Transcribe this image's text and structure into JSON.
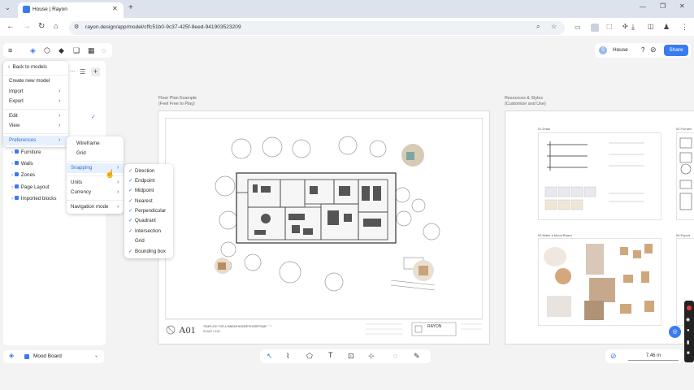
{
  "browser": {
    "tab_title": "House | Rayon",
    "url": "rayon.design/app/model/cffc51b0-9c37-425f-8eed-941903523209"
  },
  "topbar": {
    "project_name": "House",
    "avatar_initial": "S",
    "help": "?",
    "share_label": "Share"
  },
  "main_menu": {
    "back": "Back to models",
    "create": "Create new model",
    "import": "Import",
    "export": "Export",
    "edit": "Edit",
    "view": "View",
    "preferences": "Preferences"
  },
  "preferences_menu": {
    "wireframe": "Wireframe",
    "grid": "Grid",
    "snapping": "Snapping",
    "units": "Units",
    "currency": "Currency",
    "navigation_mode": "Navigation mode"
  },
  "snapping_menu": {
    "items": [
      {
        "label": "Direction",
        "checked": true
      },
      {
        "label": "Endpoint",
        "checked": true
      },
      {
        "label": "Midpoint",
        "checked": true
      },
      {
        "label": "Nearest",
        "checked": true
      },
      {
        "label": "Perpendicular",
        "checked": true
      },
      {
        "label": "Quadrant",
        "checked": true
      },
      {
        "label": "Intersection",
        "checked": true
      },
      {
        "label": "Grid",
        "checked": false
      },
      {
        "label": "Bounding box",
        "checked": true
      }
    ]
  },
  "layers": {
    "items": [
      "Furniture",
      "Walls",
      "Zones",
      "Page Layout",
      "Imported blocks"
    ]
  },
  "canvas": {
    "sheet1_title": "Floor Plan Example",
    "sheet1_subtitle": "(Feel Free to Play)",
    "sheet2_title": "Resources & Styles",
    "sheet2_subtitle": "(Customize and Use)",
    "sheet_code": "A01",
    "sheet_desc": "TEMPLATE FOR A SINGLE HOUSE FLOOR PLAN",
    "sheet_scale": "SCALE 1:100",
    "brand": "RAYON",
    "panel1": "01 Draw",
    "panel2": "02 Furnish",
    "panel3": "03 Make a Mood Board",
    "panel4": "04 Export"
  },
  "bottombar": {
    "board_label": "Mood Board",
    "measure": "7.46 m"
  },
  "colors": {
    "accent": "#3a7bf2",
    "highlight_bg": "#e7f0fd",
    "highlight_text": "#2d6fd0"
  }
}
